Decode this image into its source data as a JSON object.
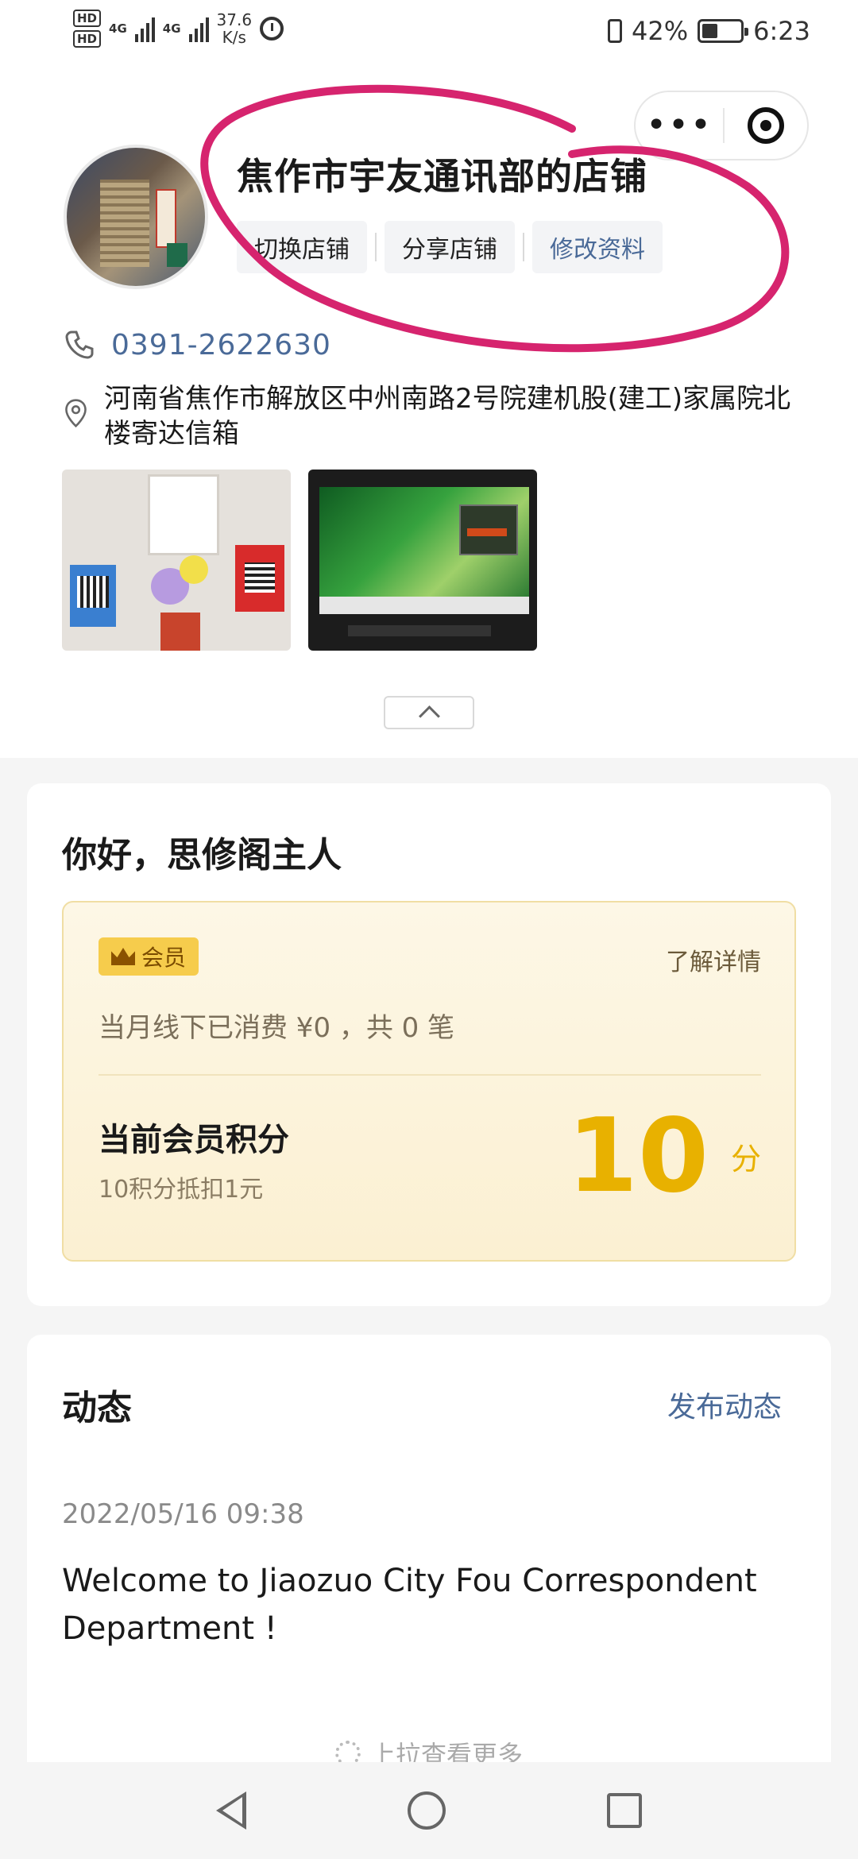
{
  "status_bar": {
    "hd1": "HD",
    "hd2": "HD",
    "net1": "4G",
    "net2": "4G",
    "speed_value": "37.6",
    "speed_unit": "K/s",
    "battery": "42%",
    "battery_level": 0.42,
    "time": "6:23"
  },
  "store": {
    "name": "焦作市宇友通讯部的店铺",
    "actions": [
      "切换店铺",
      "分享店铺",
      "修改资料"
    ],
    "phone": "0391-2622630",
    "address": "河南省焦作市解放区中州南路2号院建机股(建工)家属院北楼寄达信箱"
  },
  "welcome": {
    "greeting": "你好，思修阁主人"
  },
  "member": {
    "badge": "会员",
    "details_link": "了解详情",
    "monthly": "当月线下已消费  ¥0  ，共 0 笔",
    "points_label": "当前会员积分",
    "points_note": "10积分抵扣1元",
    "points_value": "10",
    "points_unit": "分"
  },
  "feed": {
    "title": "动态",
    "post_button": "发布动态",
    "time": "2022/05/16 09:38",
    "text": "Welcome to Jiaozuo City Fou Correspondent Department !",
    "load_more": "上拉查看更多"
  },
  "colors": {
    "accent_blue": "#4a6a98",
    "points_gold": "#e8b100",
    "annotation": "#d6246e"
  }
}
